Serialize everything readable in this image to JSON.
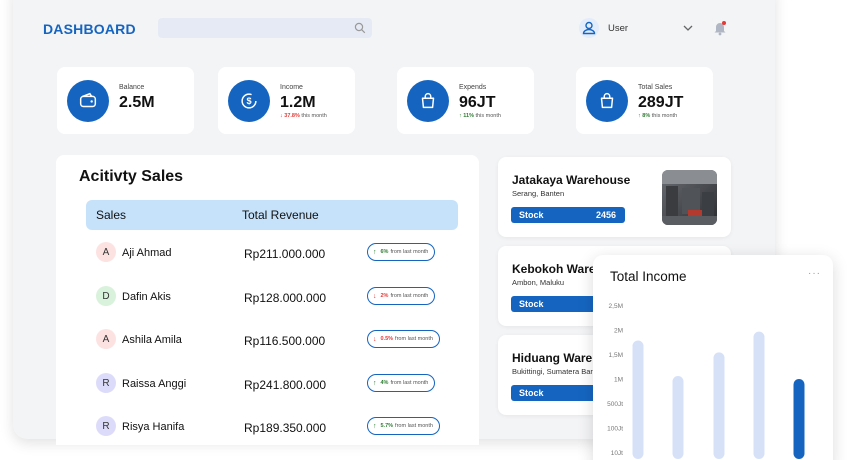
{
  "header": {
    "brand": "DASHBOARD",
    "user_name": "User",
    "icons": {
      "search": "search-icon",
      "user": "user-icon",
      "dropdown": "chevron-down-icon",
      "notification": "bell-icon"
    }
  },
  "colors": {
    "primary": "#1565c0",
    "light_blue": "#c6e2fb",
    "up": "#2e7d32",
    "down": "#e53935",
    "bar_light": "#d6e1f8"
  },
  "stats": [
    {
      "label": "Balance",
      "value": "2.5M",
      "icon": "wallet-icon"
    },
    {
      "label": "Income",
      "value": "1.2M",
      "change_arrow": "↓",
      "change_pct": "37.8%",
      "change_text": "this month",
      "icon": "dollar-refresh-icon"
    },
    {
      "label": "Expends",
      "value": "96JT",
      "change_arrow": "↑",
      "change_pct": "11%",
      "change_text": "this month",
      "icon": "shopping-bag-icon"
    },
    {
      "label": "Total Sales",
      "value": "289JT",
      "change_arrow": "↑",
      "change_pct": "8%",
      "change_text": "this month",
      "icon": "shopping-bag-icon"
    }
  ],
  "activity": {
    "title": "Acitivty Sales",
    "columns": [
      "Sales",
      "Total Revenue"
    ],
    "rows": [
      {
        "initial": "A",
        "name": "Aji Ahmad",
        "revenue": "Rp211.000.000",
        "arrow": "↑",
        "pct": "6%",
        "text": "from last month",
        "trend": "up",
        "avatar_color": "#fde2e2"
      },
      {
        "initial": "D",
        "name": "Dafin Akis",
        "revenue": "Rp128.000.000",
        "arrow": "↓",
        "pct": "2%",
        "text": "from last month",
        "trend": "down",
        "avatar_color": "#d9f2dc"
      },
      {
        "initial": "A",
        "name": "Ashila Amila",
        "revenue": "Rp116.500.000",
        "arrow": "↓",
        "pct": "0.5%",
        "text": "from last month",
        "trend": "down",
        "avatar_color": "#fde2e2"
      },
      {
        "initial": "R",
        "name": "Raissa Anggi",
        "revenue": "Rp241.800.000",
        "arrow": "↑",
        "pct": "4%",
        "text": "from last month",
        "trend": "up",
        "avatar_color": "#dcdcfa"
      },
      {
        "initial": "R",
        "name": "Risya Hanifa",
        "revenue": "Rp189.350.000",
        "arrow": "↑",
        "pct": "5.7%",
        "text": "from last month",
        "trend": "up",
        "avatar_color": "#dcdcfa"
      }
    ]
  },
  "warehouses": [
    {
      "name": "Jatakaya Warehouse",
      "location": "Serang, Banten",
      "stock_label": "Stock",
      "stock": "2456"
    },
    {
      "name": "Kebokoh Warehouse",
      "location": "Ambon, Maluku",
      "stock_label": "Stock",
      "stock": ""
    },
    {
      "name": "Hiduang Warehouse",
      "location": "Bukittingi, Sumatera Barat",
      "stock_label": "Stock",
      "stock": ""
    }
  ],
  "income_chart": {
    "title": "Total Income",
    "more": "···"
  },
  "chart_data": {
    "type": "bar",
    "title": "Total Income",
    "xlabel": "",
    "ylabel": "",
    "y_ticks": [
      "2,5M",
      "2M",
      "1,5M",
      "1M",
      "500Jt",
      "100Jt",
      "10Jt"
    ],
    "categories": [
      "",
      "",
      "",
      "",
      ""
    ],
    "values": [
      1.9,
      1.3,
      1.7,
      2.05,
      1.25
    ],
    "ylim": [
      0,
      2.5
    ],
    "highlighted_index": 4,
    "grid": false,
    "legend": "none"
  }
}
